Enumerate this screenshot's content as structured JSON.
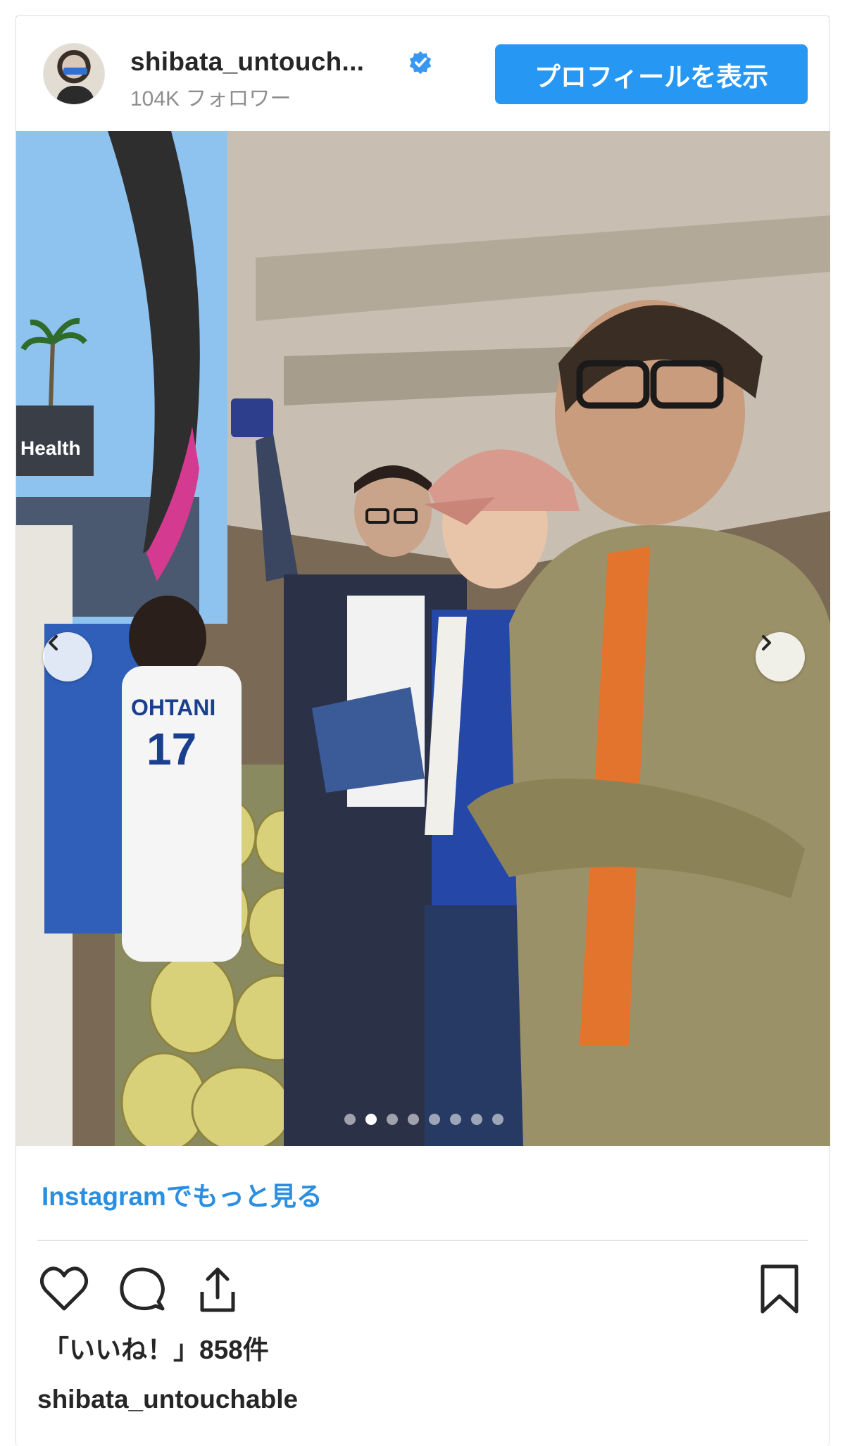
{
  "header": {
    "username": "shibata_untouch...",
    "followers": "104K フォロワー",
    "profile_button": "プロフィールを表示"
  },
  "photo": {
    "jersey_name": "OHTANI",
    "jersey_number": "17",
    "sign_text": "Health",
    "carousel": {
      "total": 8,
      "active_index": 1
    }
  },
  "footer": {
    "more_link": "Instagramでもっと見る",
    "likes": "「いいね！」858件",
    "caption_user": "shibata_untouchable"
  },
  "colors": {
    "accent": "#2697f2",
    "link": "#2a8fe0",
    "verified": "#3897f0"
  },
  "icons": {
    "like": "heart-icon",
    "comment": "comment-bubble-icon",
    "share": "share-upload-icon",
    "save": "bookmark-icon",
    "prev": "chevron-left-icon",
    "next": "chevron-right-icon"
  }
}
